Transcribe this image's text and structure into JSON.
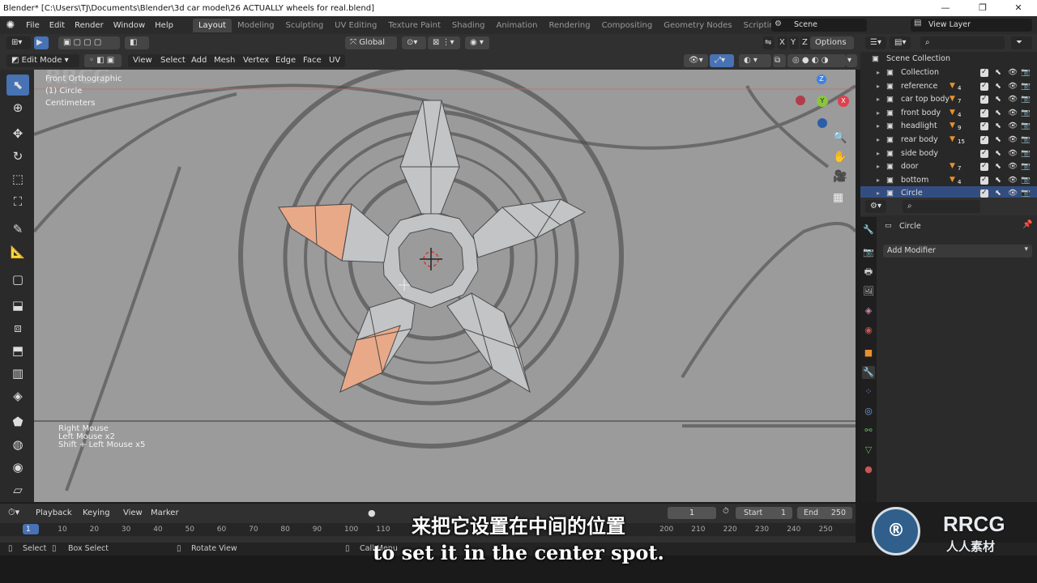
{
  "window": {
    "title": "Blender* [C:\\Users\\TJ\\Documents\\Blender\\3d car model\\26 ACTUALLY wheels for real.blend]",
    "min": "—",
    "max": "❐",
    "close": "✕"
  },
  "menu": {
    "items": [
      "File",
      "Edit",
      "Render",
      "Window",
      "Help"
    ],
    "workspaces": [
      "Layout",
      "Modeling",
      "Sculpting",
      "UV Editing",
      "Texture Paint",
      "Shading",
      "Animation",
      "Rendering",
      "Compositing",
      "Geometry Nodes",
      "Scripting"
    ],
    "active_workspace": "Layout",
    "add_tab": "+",
    "scene": "Scene",
    "view_layer": "View Layer"
  },
  "header": {
    "transform_orientation": "Global",
    "options": "Options",
    "axes": [
      "X",
      "Y",
      "Z"
    ]
  },
  "viewport_header": {
    "mode": "Edit Mode",
    "menus": [
      "View",
      "Select",
      "Add",
      "Mesh",
      "Vertex",
      "Edge",
      "Face",
      "UV"
    ]
  },
  "viewport": {
    "view_name": "Front Orthographic",
    "object_label": "(1) Circle",
    "units": "Centimeters",
    "gizmo": {
      "z": "Z",
      "y": "Y",
      "x": "X"
    },
    "input_log": [
      "Right Mouse",
      "Left Mouse x2",
      "Shift + Left Mouse x5"
    ],
    "watermark": "RRCG"
  },
  "outliner": {
    "search_placeholder": "",
    "root": "Scene Collection",
    "items": [
      {
        "name": "Collection",
        "badge": ""
      },
      {
        "name": "reference",
        "badge": "4"
      },
      {
        "name": "car top body",
        "badge": "7"
      },
      {
        "name": "front body",
        "badge": "4"
      },
      {
        "name": "headlight",
        "badge": "9"
      },
      {
        "name": "rear body",
        "badge": "15"
      },
      {
        "name": "side body",
        "badge": ""
      },
      {
        "name": "door",
        "badge": "7"
      },
      {
        "name": "bottom",
        "badge": "4"
      },
      {
        "name": "Circle",
        "badge": ""
      }
    ],
    "selected": "Circle"
  },
  "properties": {
    "object_name": "Circle",
    "add_modifier": "Add Modifier"
  },
  "timeline": {
    "menus": [
      "Playback",
      "Keying",
      "View",
      "Marker"
    ],
    "current_frame": "1",
    "start_label": "Start",
    "start": "1",
    "end_label": "End",
    "end": "250",
    "ticks": [
      "1",
      "10",
      "20",
      "30",
      "40",
      "50",
      "60",
      "70",
      "80",
      "90",
      "100",
      "110",
      "200",
      "210",
      "220",
      "230",
      "240",
      "250"
    ]
  },
  "statusbar": {
    "select": "Select",
    "box_select": "Box Select",
    "rotate_view": "Rotate View",
    "call_menu": "Call Menu"
  },
  "subtitles": {
    "zh": "来把它设置在中间的位置",
    "en": "to set it in the center spot."
  },
  "branding": {
    "logo_text": "RRCG",
    "logo_sub": "人人素材"
  },
  "colors": {
    "accent": "#4772b3",
    "selected_face": "#e8a988",
    "mesh_face": "#c2c4c6",
    "gizmo_x": "#e0404f",
    "gizmo_y": "#8bc53f",
    "gizmo_z": "#3b82e8",
    "object_icon": "#e8912f"
  }
}
